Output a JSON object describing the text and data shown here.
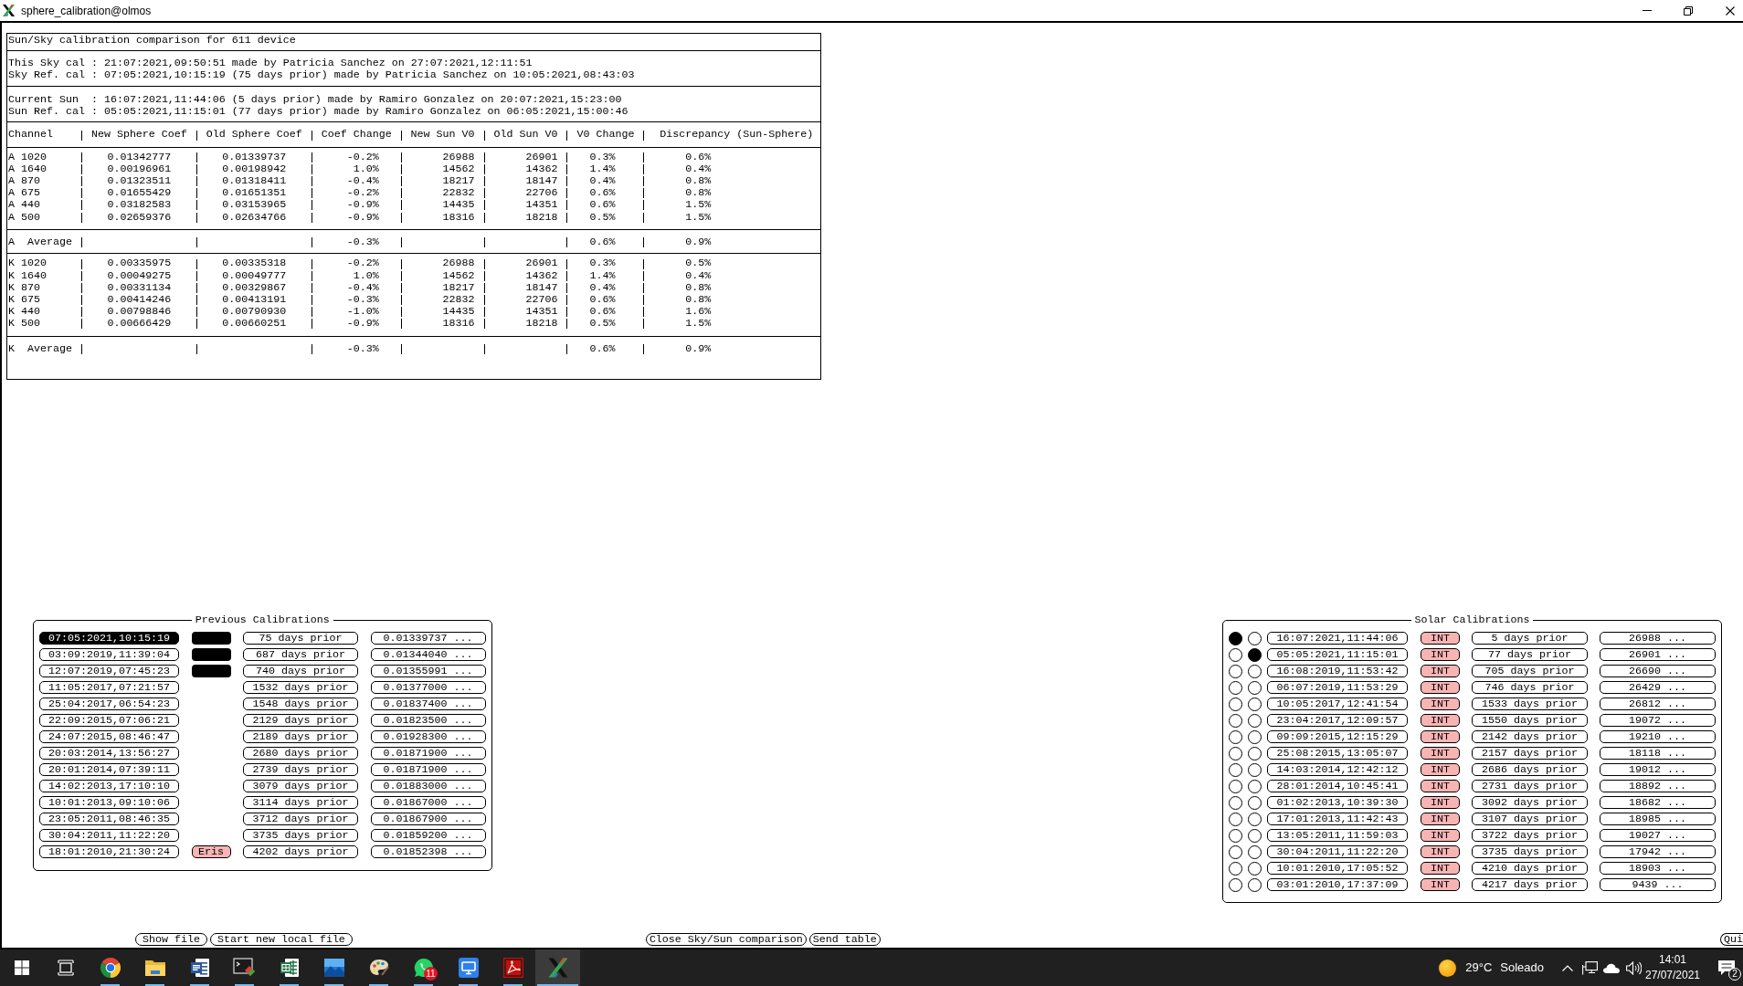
{
  "window": {
    "title": "sphere_calibration@olmos"
  },
  "report": {
    "title": "Sun/Sky calibration comparison for 611 device",
    "sky": [
      "This Sky cal : 21:07:2021,09:50:51 made by Patricia Sanchez on 27:07:2021,12:11:51",
      "Sky Ref. cal : 07:05:2021,10:15:19 (75 days prior) made by Patricia Sanchez on 10:05:2021,08:43:03"
    ],
    "sun": [
      "Current Sun  : 16:07:2021,11:44:06 (5 days prior) made by Ramiro Gonzalez on 20:07:2021,15:23:00",
      "Sun Ref. cal : 05:05:2021,11:15:01 (77 days prior) made by Ramiro Gonzalez on 06:05:2021,15:00:46"
    ],
    "columns": [
      "Channel",
      "New Sphere Coef",
      "Old Sphere Coef",
      "Coef Change",
      "New Sun V0",
      "Old Sun V0",
      "V0 Change",
      "Discrepancy (Sun-Sphere)"
    ],
    "groups": [
      {
        "rows": [
          {
            "channel": "A 1020",
            "new_sphere_coef": "0.01342777",
            "old_sphere_coef": "0.01339737",
            "coef_change": "-0.2%",
            "new_sun_v0": "26988",
            "old_sun_v0": "26901",
            "v0_change": "0.3%",
            "discrepancy": "0.6%"
          },
          {
            "channel": "A 1640",
            "new_sphere_coef": "0.00196961",
            "old_sphere_coef": "0.00198942",
            "coef_change": "1.0%",
            "new_sun_v0": "14562",
            "old_sun_v0": "14362",
            "v0_change": "1.4%",
            "discrepancy": "0.4%"
          },
          {
            "channel": "A 870",
            "new_sphere_coef": "0.01323511",
            "old_sphere_coef": "0.01318411",
            "coef_change": "-0.4%",
            "new_sun_v0": "18217",
            "old_sun_v0": "18147",
            "v0_change": "0.4%",
            "discrepancy": "0.8%"
          },
          {
            "channel": "A 675",
            "new_sphere_coef": "0.01655429",
            "old_sphere_coef": "0.01651351",
            "coef_change": "-0.2%",
            "new_sun_v0": "22832",
            "old_sun_v0": "22706",
            "v0_change": "0.6%",
            "discrepancy": "0.8%"
          },
          {
            "channel": "A 440",
            "new_sphere_coef": "0.03182583",
            "old_sphere_coef": "0.03153965",
            "coef_change": "-0.9%",
            "new_sun_v0": "14435",
            "old_sun_v0": "14351",
            "v0_change": "0.6%",
            "discrepancy": "1.5%"
          },
          {
            "channel": "A 500",
            "new_sphere_coef": "0.02659376",
            "old_sphere_coef": "0.02634766",
            "coef_change": "-0.9%",
            "new_sun_v0": "18316",
            "old_sun_v0": "18218",
            "v0_change": "0.5%",
            "discrepancy": "1.5%"
          }
        ],
        "average": {
          "channel": "A  Average",
          "coef_change": "-0.3%",
          "v0_change": "0.6%",
          "discrepancy": "0.9%"
        }
      },
      {
        "rows": [
          {
            "channel": "K 1020",
            "new_sphere_coef": "0.00335975",
            "old_sphere_coef": "0.00335318",
            "coef_change": "-0.2%",
            "new_sun_v0": "26988",
            "old_sun_v0": "26901",
            "v0_change": "0.3%",
            "discrepancy": "0.5%"
          },
          {
            "channel": "K 1640",
            "new_sphere_coef": "0.00049275",
            "old_sphere_coef": "0.00049777",
            "coef_change": "1.0%",
            "new_sun_v0": "14562",
            "old_sun_v0": "14362",
            "v0_change": "1.4%",
            "discrepancy": "0.4%"
          },
          {
            "channel": "K 870",
            "new_sphere_coef": "0.00331134",
            "old_sphere_coef": "0.00329867",
            "coef_change": "-0.4%",
            "new_sun_v0": "18217",
            "old_sun_v0": "18147",
            "v0_change": "0.4%",
            "discrepancy": "0.8%"
          },
          {
            "channel": "K 675",
            "new_sphere_coef": "0.00414246",
            "old_sphere_coef": "0.00413191",
            "coef_change": "-0.3%",
            "new_sun_v0": "22832",
            "old_sun_v0": "22706",
            "v0_change": "0.6%",
            "discrepancy": "0.8%"
          },
          {
            "channel": "K 440",
            "new_sphere_coef": "0.00798846",
            "old_sphere_coef": "0.00790930",
            "coef_change": "-1.0%",
            "new_sun_v0": "14435",
            "old_sun_v0": "14351",
            "v0_change": "0.6%",
            "discrepancy": "1.6%"
          },
          {
            "channel": "K 500",
            "new_sphere_coef": "0.00666429",
            "old_sphere_coef": "0.00660251",
            "coef_change": "-0.9%",
            "new_sun_v0": "18316",
            "old_sun_v0": "18218",
            "v0_change": "0.5%",
            "discrepancy": "1.5%"
          }
        ],
        "average": {
          "channel": "K  Average",
          "coef_change": "-0.3%",
          "v0_change": "0.6%",
          "discrepancy": "0.9%"
        }
      }
    ]
  },
  "previous_calibrations": {
    "title": "Previous Calibrations",
    "rows": [
      {
        "date": "07:05:2021,10:15:19",
        "selected": true,
        "color": "#000000",
        "age": "75 days prior",
        "value": "0.01339737 ..."
      },
      {
        "date": "03:09:2019,11:39:04",
        "selected": false,
        "color": "#000000",
        "age": "687 days prior",
        "value": "0.01344040 ..."
      },
      {
        "date": "12:07:2019,07:45:23",
        "selected": false,
        "color": "#000000",
        "age": "740 days prior",
        "value": "0.01355991 ..."
      },
      {
        "date": "11:05:2017,07:21:57",
        "selected": false,
        "age": "1532 days prior",
        "value": "0.01377000 ..."
      },
      {
        "date": "25:04:2017,06:54:23",
        "selected": false,
        "age": "1548 days prior",
        "value": "0.01837400 ..."
      },
      {
        "date": "22:09:2015,07:06:21",
        "selected": false,
        "age": "2129 days prior",
        "value": "0.01823500 ..."
      },
      {
        "date": "24:07:2015,08:46:47",
        "selected": false,
        "age": "2189 days prior",
        "value": "0.01928300 ..."
      },
      {
        "date": "20:03:2014,13:56:27",
        "selected": false,
        "age": "2680 days prior",
        "value": "0.01871900 ..."
      },
      {
        "date": "20:01:2014,07:39:11",
        "selected": false,
        "age": "2739 days prior",
        "value": "0.01871900 ..."
      },
      {
        "date": "14:02:2013,17:10:10",
        "selected": false,
        "age": "3079 days prior",
        "value": "0.01883000 ..."
      },
      {
        "date": "10:01:2013,09:10:06",
        "selected": false,
        "age": "3114 days prior",
        "value": "0.01867000 ..."
      },
      {
        "date": "23:05:2011,08:46:35",
        "selected": false,
        "age": "3712 days prior",
        "value": "0.01867900 ..."
      },
      {
        "date": "30:04:2011,11:22:20",
        "selected": false,
        "age": "3735 days prior",
        "value": "0.01859200 ..."
      },
      {
        "date": "18:01:2010,21:30:24",
        "selected": false,
        "tag": "Eris",
        "age": "4202 days prior",
        "value": "0.01852398 ..."
      }
    ]
  },
  "solar_calibrations": {
    "title": "Solar Calibrations",
    "rows": [
      {
        "current": true,
        "reference": false,
        "date": "16:07:2021,11:44:06",
        "tag": "INT",
        "age": "5 days prior",
        "value": "26988 ..."
      },
      {
        "current": false,
        "reference": true,
        "date": "05:05:2021,11:15:01",
        "tag": "INT",
        "age": "77 days prior",
        "value": "26901 ..."
      },
      {
        "current": false,
        "reference": false,
        "date": "16:08:2019,11:53:42",
        "tag": "INT",
        "age": "705 days prior",
        "value": "26690 ..."
      },
      {
        "current": false,
        "reference": false,
        "date": "06:07:2019,11:53:29",
        "tag": "INT",
        "age": "746 days prior",
        "value": "26429 ..."
      },
      {
        "current": false,
        "reference": false,
        "date": "10:05:2017,12:41:54",
        "tag": "INT",
        "age": "1533 days prior",
        "value": "26812 ..."
      },
      {
        "current": false,
        "reference": false,
        "date": "23:04:2017,12:09:57",
        "tag": "INT",
        "age": "1550 days prior",
        "value": "19072 ..."
      },
      {
        "current": false,
        "reference": false,
        "date": "09:09:2015,12:15:29",
        "tag": "INT",
        "age": "2142 days prior",
        "value": "19210 ..."
      },
      {
        "current": false,
        "reference": false,
        "date": "25:08:2015,13:05:07",
        "tag": "INT",
        "age": "2157 days prior",
        "value": "18118 ..."
      },
      {
        "current": false,
        "reference": false,
        "date": "14:03:2014,12:42:12",
        "tag": "INT",
        "age": "2686 days prior",
        "value": "19012 ..."
      },
      {
        "current": false,
        "reference": false,
        "date": "28:01:2014,10:45:41",
        "tag": "INT",
        "age": "2731 days prior",
        "value": "18892 ..."
      },
      {
        "current": false,
        "reference": false,
        "date": "01:02:2013,10:39:30",
        "tag": "INT",
        "age": "3092 days prior",
        "value": "18682 ..."
      },
      {
        "current": false,
        "reference": false,
        "date": "17:01:2013,11:42:43",
        "tag": "INT",
        "age": "3107 days prior",
        "value": "18985 ..."
      },
      {
        "current": false,
        "reference": false,
        "date": "13:05:2011,11:59:03",
        "tag": "INT",
        "age": "3722 days prior",
        "value": "19027 ..."
      },
      {
        "current": false,
        "reference": false,
        "date": "30:04:2011,11:22:20",
        "tag": "INT",
        "age": "3735 days prior",
        "value": "17942 ..."
      },
      {
        "current": false,
        "reference": false,
        "date": "10:01:2010,17:05:52",
        "tag": "INT",
        "age": "4210 days prior",
        "value": "18903 ..."
      },
      {
        "current": false,
        "reference": false,
        "date": "03:01:2010,17:37:09",
        "tag": "INT",
        "age": "4217 days prior",
        "value": "9439 ..."
      }
    ]
  },
  "buttons": {
    "left": [
      "Show file",
      "Start new local file"
    ],
    "center": [
      "Close Sky/Sun comparison",
      "Send table"
    ],
    "right": [
      "Qui"
    ]
  },
  "taskbar": {
    "apps": [
      {
        "kind": "browser",
        "running": true,
        "active": false
      },
      {
        "kind": "folder",
        "running": true,
        "active": false
      },
      {
        "kind": "word",
        "running": true,
        "active": false
      },
      {
        "kind": "terminal",
        "running": true,
        "active": false
      },
      {
        "kind": "spreadsheet",
        "running": true,
        "active": false
      },
      {
        "kind": "photos",
        "running": true,
        "active": false
      },
      {
        "kind": "paint",
        "running": true,
        "active": false
      },
      {
        "kind": "chat",
        "running": true,
        "active": false,
        "badge": "11"
      },
      {
        "kind": "remote",
        "running": true,
        "active": false
      },
      {
        "kind": "pdf",
        "running": true,
        "active": false
      },
      {
        "kind": "xserver",
        "running": true,
        "active": true
      }
    ],
    "weather": {
      "temperature": "29°C",
      "condition": "Soleado"
    },
    "clock": {
      "time": "14:01",
      "date": "27/07/2021"
    },
    "notifications": {
      "badge": "2"
    }
  }
}
